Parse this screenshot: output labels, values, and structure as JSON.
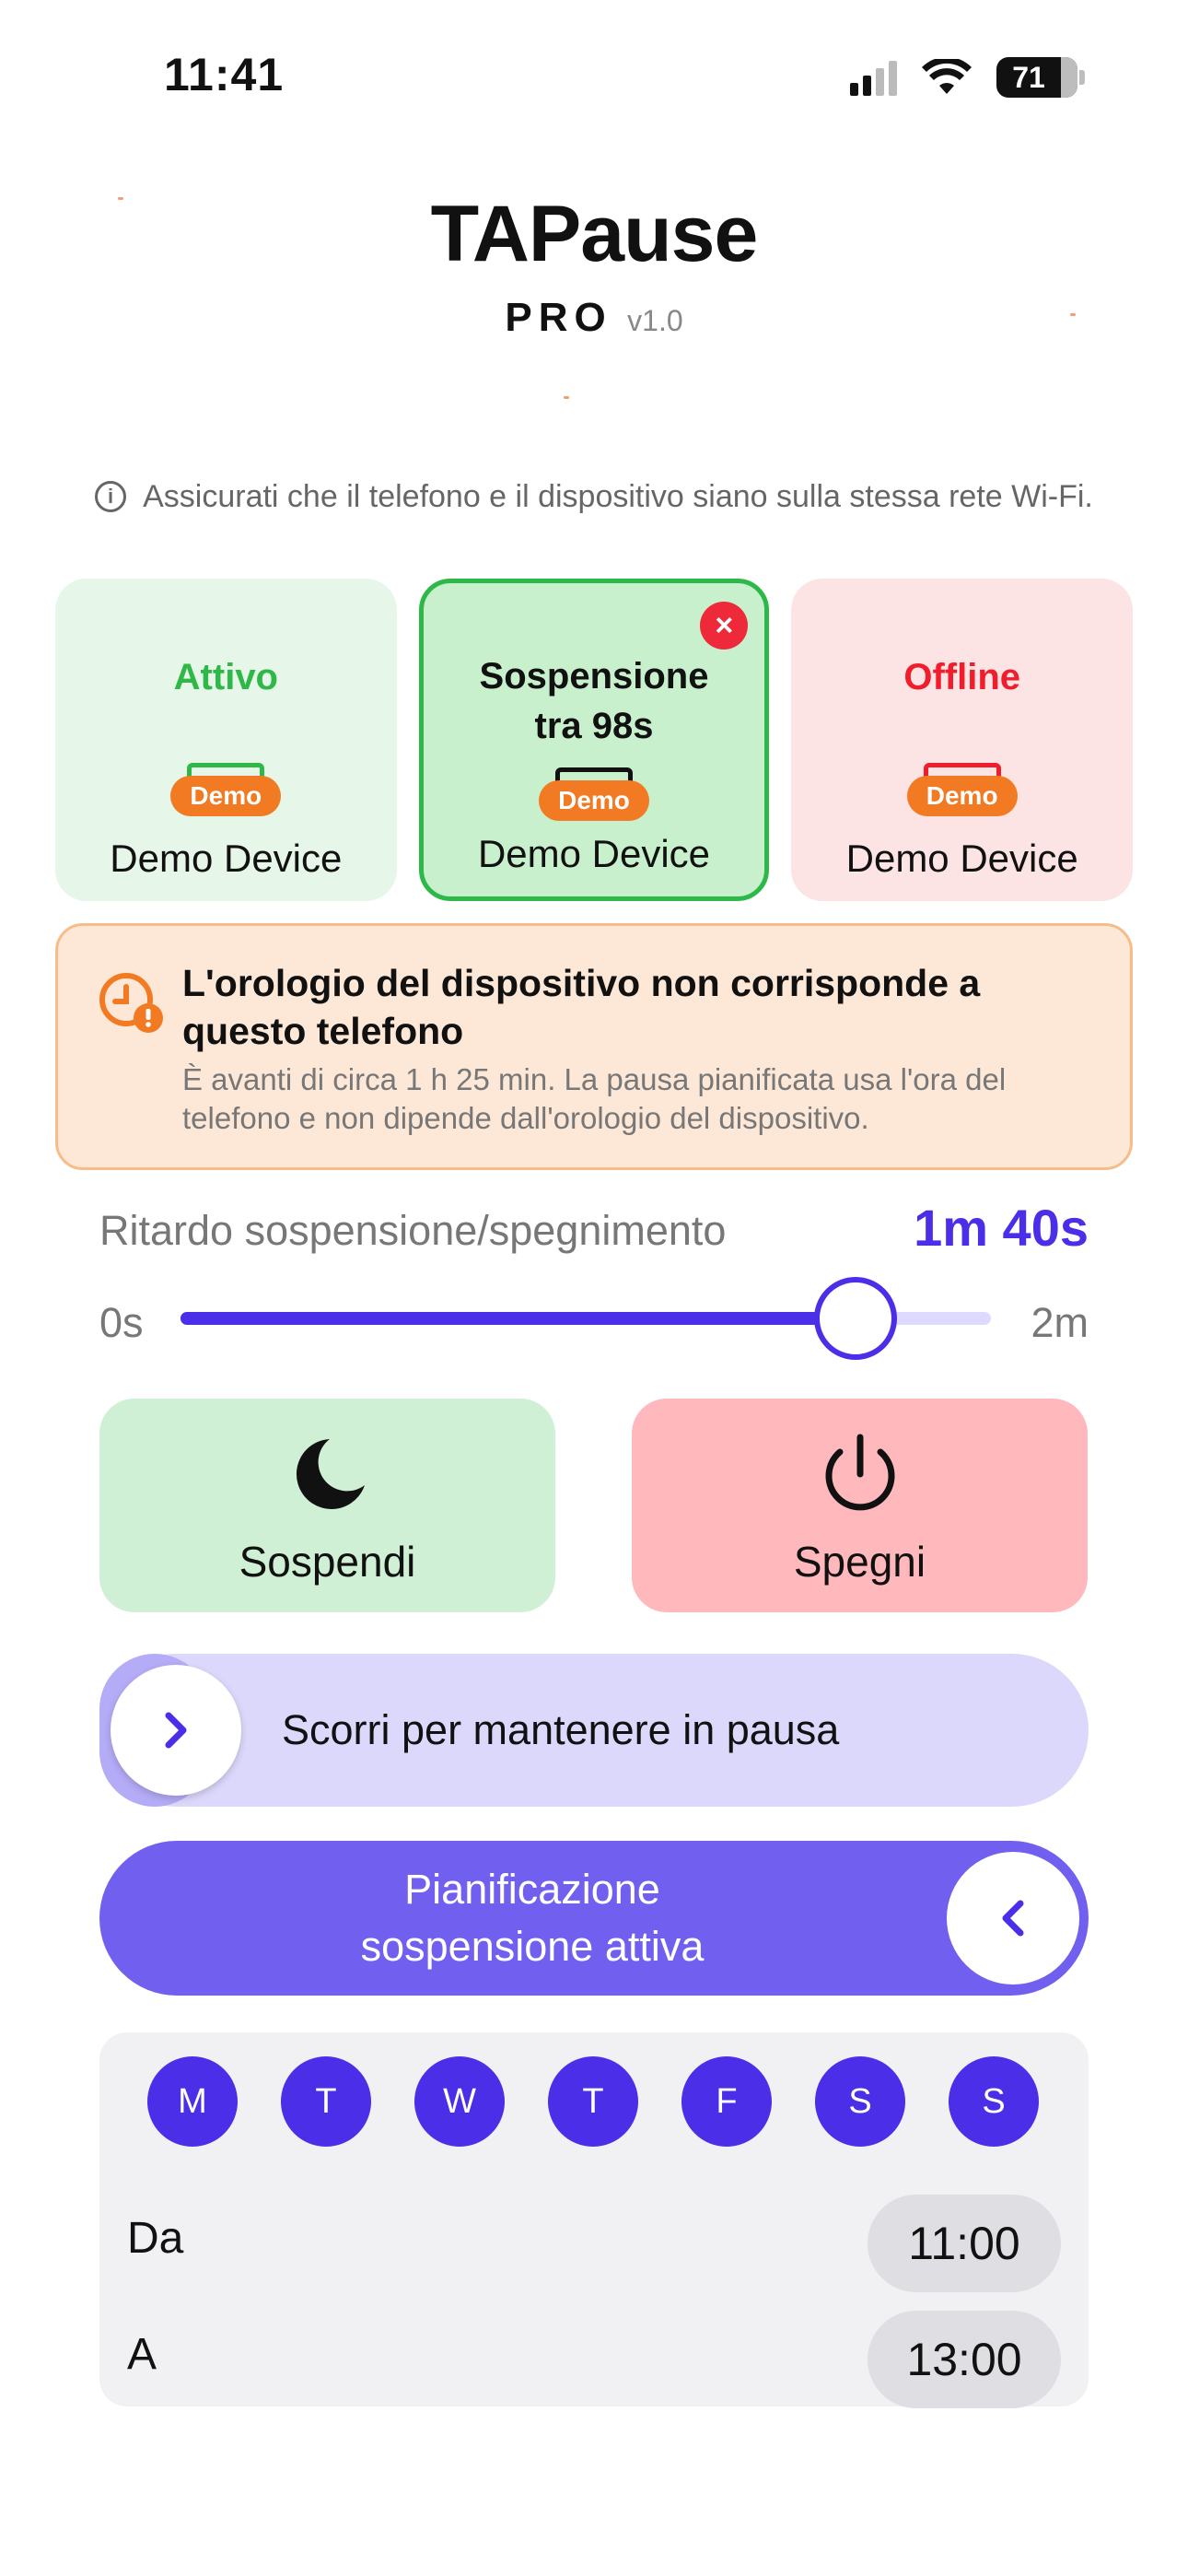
{
  "status_bar": {
    "time": "11:41",
    "battery": "71",
    "icons": [
      "cellular-signal-icon",
      "wifi-icon",
      "battery-icon"
    ]
  },
  "header": {
    "title": "TAPause",
    "edition": "PRO",
    "version": "v1.0"
  },
  "info": {
    "icon": "info-icon",
    "text": "Assicurati che il telefono e il dispositivo siano sulla stessa rete Wi-Fi."
  },
  "devices": [
    {
      "status": "Attivo",
      "badge": "Demo",
      "name": "Demo Device",
      "color": "#2fb848"
    },
    {
      "status": "Sospensione tra 98s",
      "badge": "Demo",
      "name": "Demo Device",
      "color": "#2db84a",
      "close": "×"
    },
    {
      "status": "Offline",
      "badge": "Demo",
      "name": "Demo Device",
      "color": "#f01e2c"
    }
  ],
  "warning": {
    "icon": "clock-alert-icon",
    "title": "L'orologio del dispositivo non corrisponde a questo telefono",
    "body": "È avanti di circa 1 h 25 min. La pausa pianificata usa l'ora del telefono e non dipende dall'orologio del dispositivo."
  },
  "delay": {
    "label": "Ritardo sospensione/spegnimento",
    "value": "1m 40s",
    "min_label": "0s",
    "max_label": "2m",
    "fraction": 0.833
  },
  "actions": {
    "sleep": {
      "label": "Sospendi",
      "icon": "moon-icon"
    },
    "shutdown": {
      "label": "Spegni",
      "icon": "power-icon"
    }
  },
  "swipe": {
    "label": "Scorri per mantenere in pausa",
    "icon": "chevron-right-icon"
  },
  "schedule_toggle": {
    "label_line1": "Pianificazione",
    "label_line2": "sospensione attiva",
    "icon": "chevron-left-icon"
  },
  "schedule": {
    "days": [
      "M",
      "T",
      "W",
      "T",
      "F",
      "S",
      "S"
    ],
    "from_label": "Da",
    "from_time": "11:00",
    "to_label": "A",
    "to_time": "13:00"
  },
  "colors": {
    "accent": "#4a2ee8",
    "schedule_bg": "#7160f0",
    "warning_bg": "#fde8d8",
    "demo_badge": "#f27a23"
  }
}
